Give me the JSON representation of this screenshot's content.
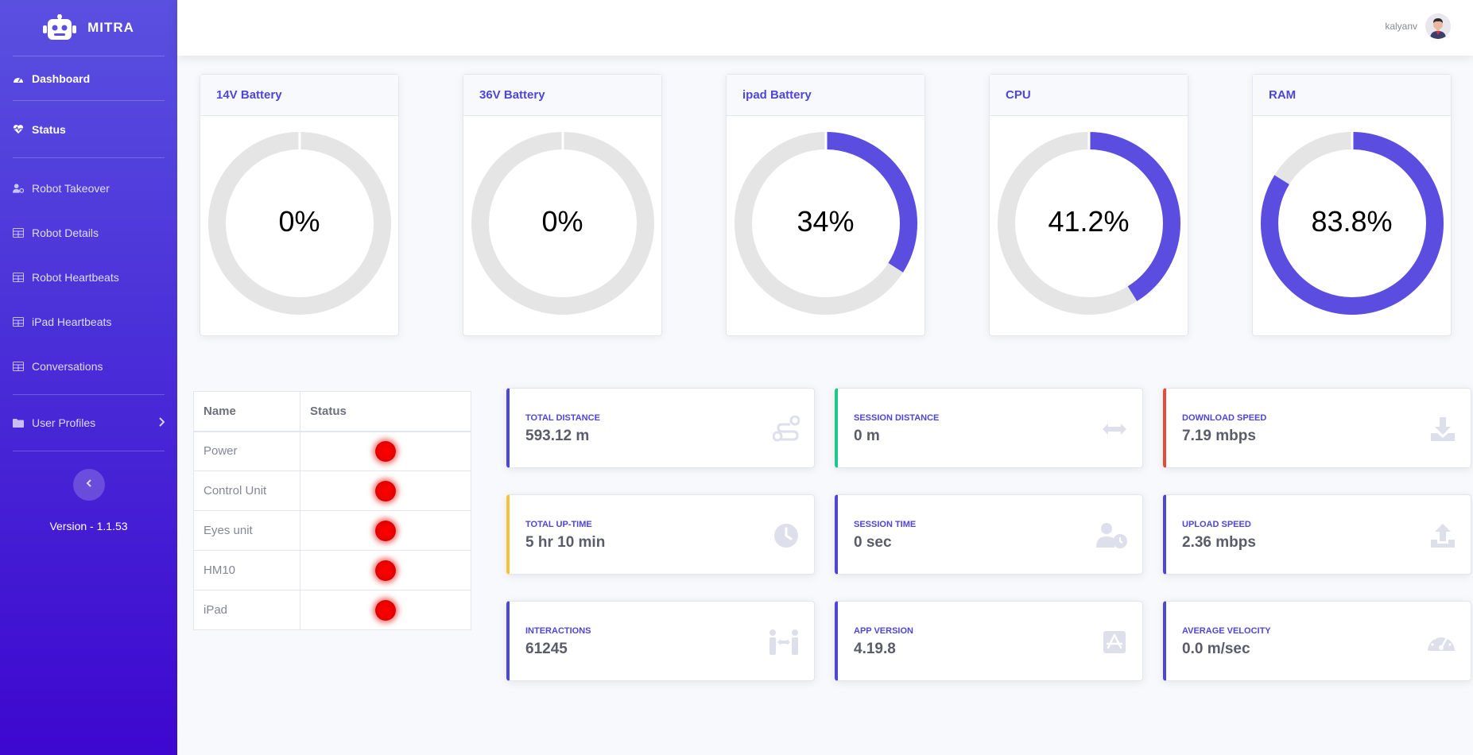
{
  "brand": {
    "name": "MITRA"
  },
  "sidebar": {
    "dashboard": "Dashboard",
    "status": "Status",
    "items": [
      {
        "label": "Robot Takeover",
        "icon": "user-cog-icon"
      },
      {
        "label": "Robot Details",
        "icon": "table-icon"
      },
      {
        "label": "Robot Heartbeats",
        "icon": "table-icon"
      },
      {
        "label": "iPad Heartbeats",
        "icon": "table-icon"
      },
      {
        "label": "Conversations",
        "icon": "table-icon"
      }
    ],
    "user_profiles": "User Profiles",
    "toggle_icon": "chevron-left-icon",
    "version": "Version - 1.1.53"
  },
  "topbar": {
    "username": "kalyanv"
  },
  "gauges": [
    {
      "title": "14V Battery",
      "value_label": "0%",
      "percent": 0
    },
    {
      "title": "36V Battery",
      "value_label": "0%",
      "percent": 0
    },
    {
      "title": "ipad Battery",
      "value_label": "34%",
      "percent": 34
    },
    {
      "title": "CPU",
      "value_label": "41.2%",
      "percent": 41.2
    },
    {
      "title": "RAM",
      "value_label": "83.8%",
      "percent": 83.8
    }
  ],
  "colors": {
    "accent": "#5a4de0",
    "track": "#e5e5e5",
    "status_off": "#ff0000"
  },
  "status_table": {
    "headers": [
      "Name",
      "Status"
    ],
    "rows": [
      {
        "name": "Power",
        "status": "off"
      },
      {
        "name": "Control Unit",
        "status": "off"
      },
      {
        "name": "Eyes unit",
        "status": "off"
      },
      {
        "name": "HM10",
        "status": "off"
      },
      {
        "name": "iPad",
        "status": "off"
      }
    ]
  },
  "stats": [
    {
      "label": "TOTAL DISTANCE",
      "value": "593.12 m",
      "icon": "route-icon",
      "border": "#4e46d8"
    },
    {
      "label": "SESSION DISTANCE",
      "value": "0 m",
      "icon": "arrows-horizontal-icon",
      "border": "#1cc88a"
    },
    {
      "label": "DOWNLOAD SPEED",
      "value": "7.19 mbps",
      "icon": "download-icon",
      "border": "#e74a3b"
    },
    {
      "label": "TOTAL UP-TIME",
      "value": "5 hr 10 min",
      "icon": "clock-icon",
      "border": "#f6c23e"
    },
    {
      "label": "SESSION TIME",
      "value": "0 sec",
      "icon": "user-clock-icon",
      "border": "#4e46d8"
    },
    {
      "label": "UPLOAD SPEED",
      "value": "2.36 mbps",
      "icon": "upload-icon",
      "border": "#4e46d8"
    },
    {
      "label": "INTERACTIONS",
      "value": "61245",
      "icon": "people-arrows-icon",
      "border": "#4e46d8"
    },
    {
      "label": "APP VERSION",
      "value": "4.19.8",
      "icon": "app-store-icon",
      "border": "#4e46d8"
    },
    {
      "label": "AVERAGE VELOCITY",
      "value": "0.0 m/sec",
      "icon": "speedometer-icon",
      "border": "#4e46d8"
    }
  ]
}
